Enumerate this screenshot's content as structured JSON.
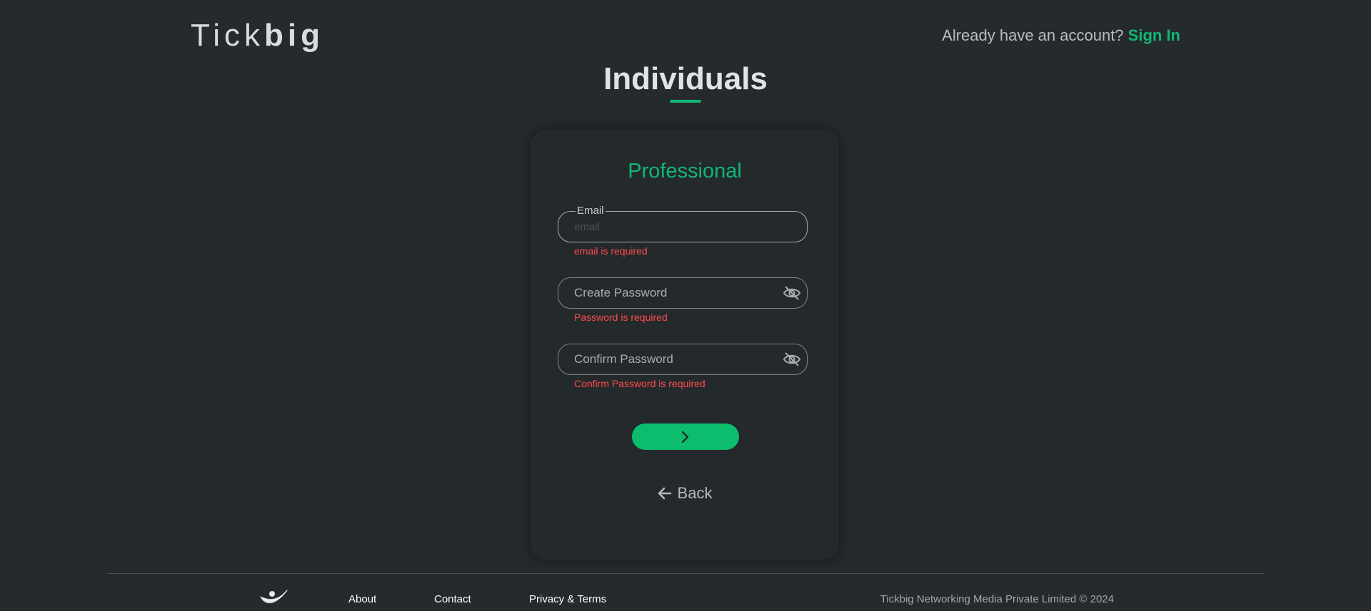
{
  "header": {
    "logo_light": "Tick",
    "logo_bold": "big",
    "account_prompt": "Already have an account?",
    "signin_label": "Sign In"
  },
  "page_title": "Individuals",
  "form": {
    "heading": "Professional",
    "email": {
      "label": "Email",
      "placeholder": "email",
      "value": "",
      "error": "email is required"
    },
    "password": {
      "placeholder": "Create Password",
      "value": "",
      "error": "Password is required",
      "icon": "eye-off-icon"
    },
    "confirm_password": {
      "placeholder": "Confirm Password",
      "value": "",
      "error": "Confirm Password is required",
      "icon": "eye-off-icon"
    },
    "next_icon": "chevron-right-icon",
    "back_label": "Back",
    "back_icon": "arrow-left-icon"
  },
  "footer": {
    "links": [
      "About",
      "Contact",
      "Privacy & Terms"
    ],
    "copyright": "Tickbig Networking Media Private Limited © 2024"
  },
  "colors": {
    "background": "#252a2d",
    "accent": "#10b874",
    "error": "#ff4a4a"
  }
}
